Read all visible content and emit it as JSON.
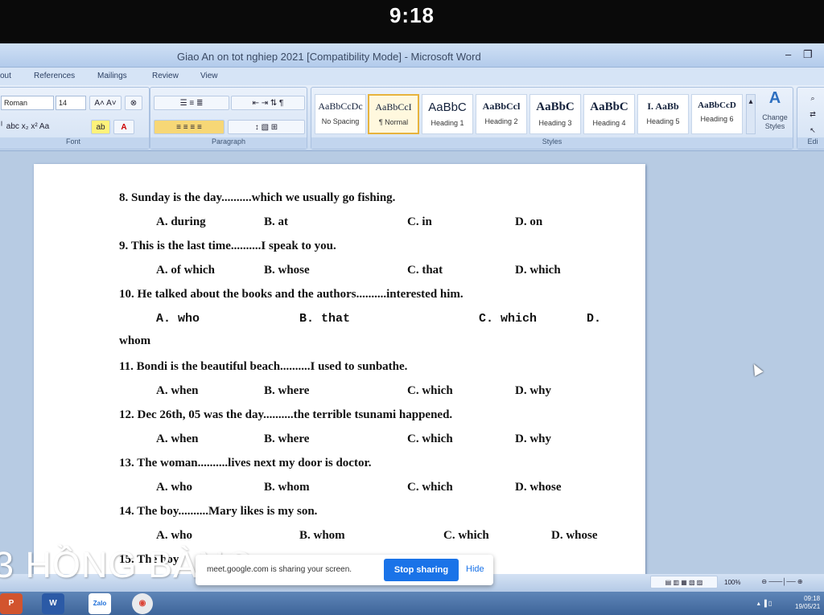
{
  "phone": {
    "time": "9:18"
  },
  "window": {
    "title": "Giao An on tot nghiep 2021 [Compatibility Mode] - Microsoft Word",
    "minimize": "–",
    "restore": "❐"
  },
  "tabs": [
    "out",
    "References",
    "Mailings",
    "Review",
    "View"
  ],
  "ribbon": {
    "font": {
      "name": "Roman",
      "size": "14",
      "label": "Font"
    },
    "paragraph": {
      "label": "Paragraph"
    },
    "styles": {
      "label": "Styles",
      "tiles": [
        {
          "sample": "AaBbCcDc",
          "name": "No Spacing"
        },
        {
          "sample": "AaBbCcI",
          "name": "¶ Normal"
        },
        {
          "sample": "AaBbC",
          "name": "Heading 1"
        },
        {
          "sample": "AaBbCcl",
          "name": "Heading 2"
        },
        {
          "sample": "AaBbC",
          "name": "Heading 3"
        },
        {
          "sample": "AaBbC",
          "name": "Heading 4"
        },
        {
          "sample": "I. AaBb",
          "name": "Heading 5"
        },
        {
          "sample": "AaBbCcD",
          "name": "Heading 6"
        }
      ],
      "change": "Change Styles"
    },
    "editing": {
      "label": "Edi"
    }
  },
  "document": {
    "q8": {
      "text": "8. Sunday is the day..........which we usually go fishing.",
      "a": "A. during",
      "b": "B. at",
      "c": "C. in",
      "d": "D. on"
    },
    "q9": {
      "text": "9. This is the last time..........I speak to you.",
      "a": "A. of which",
      "b": "B. whose",
      "c": "C. that",
      "d": "D. which"
    },
    "q10": {
      "text": "10. He talked about the books and the authors..........interested him.",
      "a": "A. who",
      "b": "B. that",
      "c": "C. which",
      "d": "D.",
      "cont": "whom"
    },
    "q11": {
      "text": "11. Bondi is the beautiful beach..........I used to sunbathe.",
      "a": "A. when",
      "b": "B. where",
      "c": "C. which",
      "d": "D. why"
    },
    "q12": {
      "text": "12. Dec 26th, 05 was the day..........the terrible tsunami happened.",
      "a": "A. when",
      "b": "B. where",
      "c": "C. which",
      "d": "D. why"
    },
    "q13": {
      "text": "13. The woman..........lives next my door is doctor.",
      "a": "A. who",
      "b": "B. whom",
      "c": "C. which",
      "d": "D. whose"
    },
    "q14": {
      "text": "14. The boy..........Mary likes is my son.",
      "a": "A. who",
      "b": "B. whom",
      "c": "C. which",
      "d": "D. whose"
    },
    "q15": {
      "text": "15. The boy"
    }
  },
  "status": {
    "zoom": "100%"
  },
  "taskbar": {
    "clock_time": "09:18",
    "clock_date": "19/05/21",
    "zalo": "Zalo"
  },
  "overlay": {
    "watermark": "3 HỒNG BÀNG",
    "share_text": "meet.google.com is sharing your screen.",
    "stop": "Stop sharing",
    "hide": "Hide"
  }
}
